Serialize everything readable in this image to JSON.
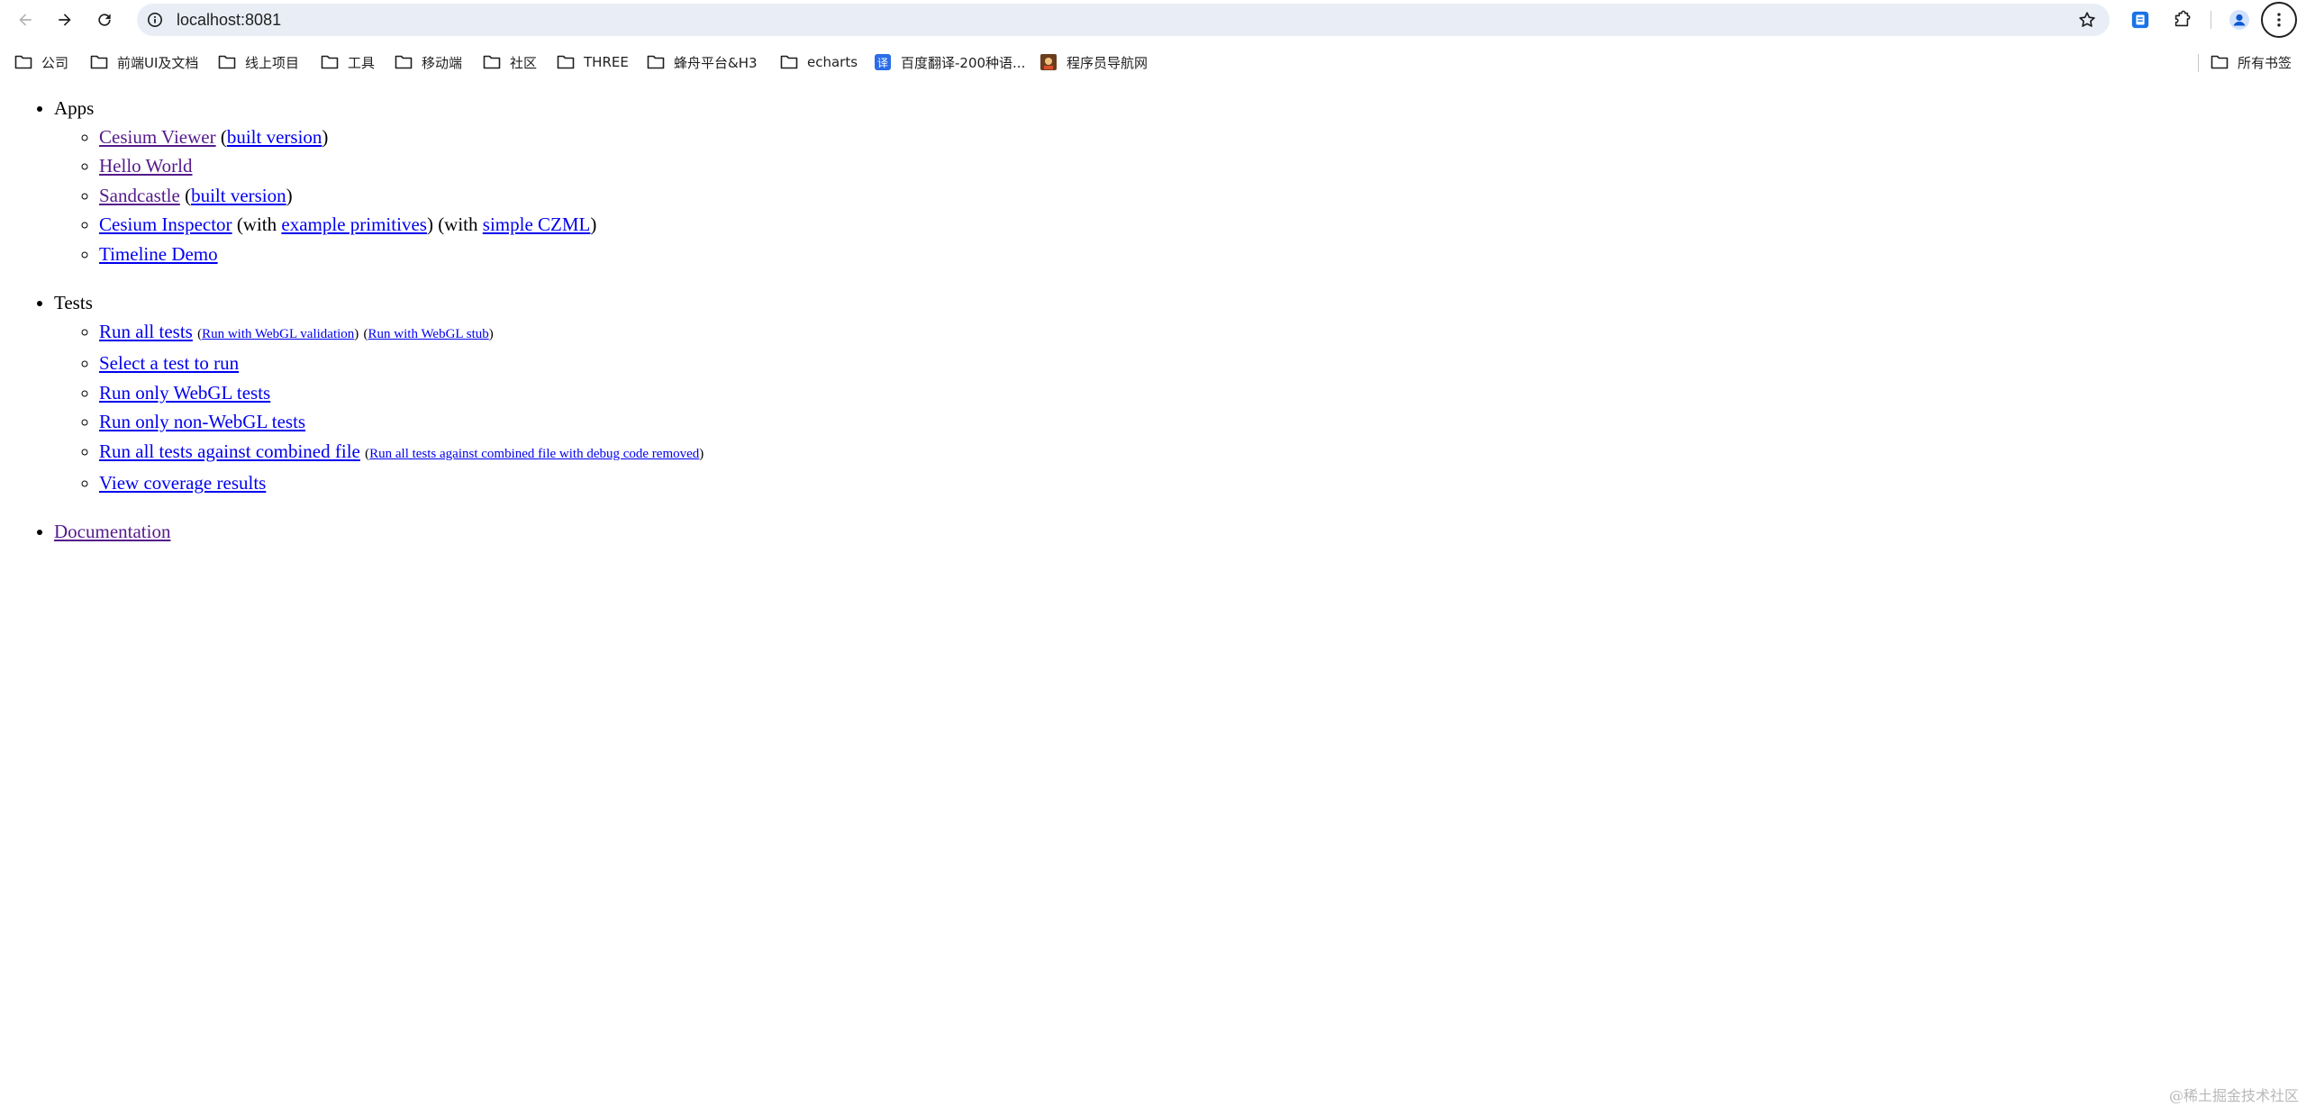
{
  "browser": {
    "url": "localhost:8081",
    "icons": {
      "back": "back-arrow-icon",
      "forward": "forward-arrow-icon",
      "reload": "reload-icon",
      "site_info": "info-icon",
      "bookmark_star": "star-icon",
      "extensions": "puzzle-icon",
      "profile": "profile-icon",
      "menu": "kebab-menu-icon"
    }
  },
  "bookmarks": {
    "items": [
      {
        "label": "公司",
        "icon": "folder-icon"
      },
      {
        "label": "前端UI及文档",
        "icon": "folder-icon"
      },
      {
        "label": "线上项目",
        "icon": "folder-icon"
      },
      {
        "label": "工具",
        "icon": "folder-icon"
      },
      {
        "label": "移动端",
        "icon": "folder-icon"
      },
      {
        "label": "社区",
        "icon": "folder-icon"
      },
      {
        "label": "THREE",
        "icon": "folder-icon"
      },
      {
        "label": "蜂舟平台&H3",
        "icon": "folder-icon"
      },
      {
        "label": "echarts",
        "icon": "folder-icon"
      },
      {
        "label": "百度翻译-200种语...",
        "icon": "baidu-translate-icon"
      },
      {
        "label": "程序员导航网",
        "icon": "site-favicon"
      }
    ],
    "all_bookmarks": {
      "label": "所有书签",
      "icon": "folder-icon"
    }
  },
  "page": {
    "apps": {
      "heading": "Apps",
      "cesium_viewer": "Cesium Viewer",
      "built_version": "built version",
      "hello_world": "Hello World",
      "sandcastle": "Sandcastle",
      "cesium_inspector": "Cesium Inspector",
      "with_text": "(with",
      "example_primitives": "example primitives",
      "simple_czml": "simple CZML",
      "timeline_demo": "Timeline Demo"
    },
    "tests": {
      "heading": "Tests",
      "run_all": "Run all tests",
      "run_webgl_validation": "Run with WebGL validation",
      "run_webgl_stub": "Run with WebGL stub",
      "select_test": "Select a test to run",
      "run_webgl_only": "Run only WebGL tests",
      "run_non_webgl": "Run only non-WebGL tests",
      "run_combined": "Run all tests against combined file",
      "run_combined_debug_removed": "Run all tests against combined file with debug code removed",
      "view_coverage": "View coverage results"
    },
    "documentation": "Documentation"
  },
  "watermark": "@稀土掘金技术社区",
  "colors": {
    "link": "#0000ee",
    "visited_link": "#551a8b",
    "omnibox_bg": "#e9eef6",
    "extension_accent": "#1a73e8",
    "profile_accent": "#0b57d0"
  }
}
